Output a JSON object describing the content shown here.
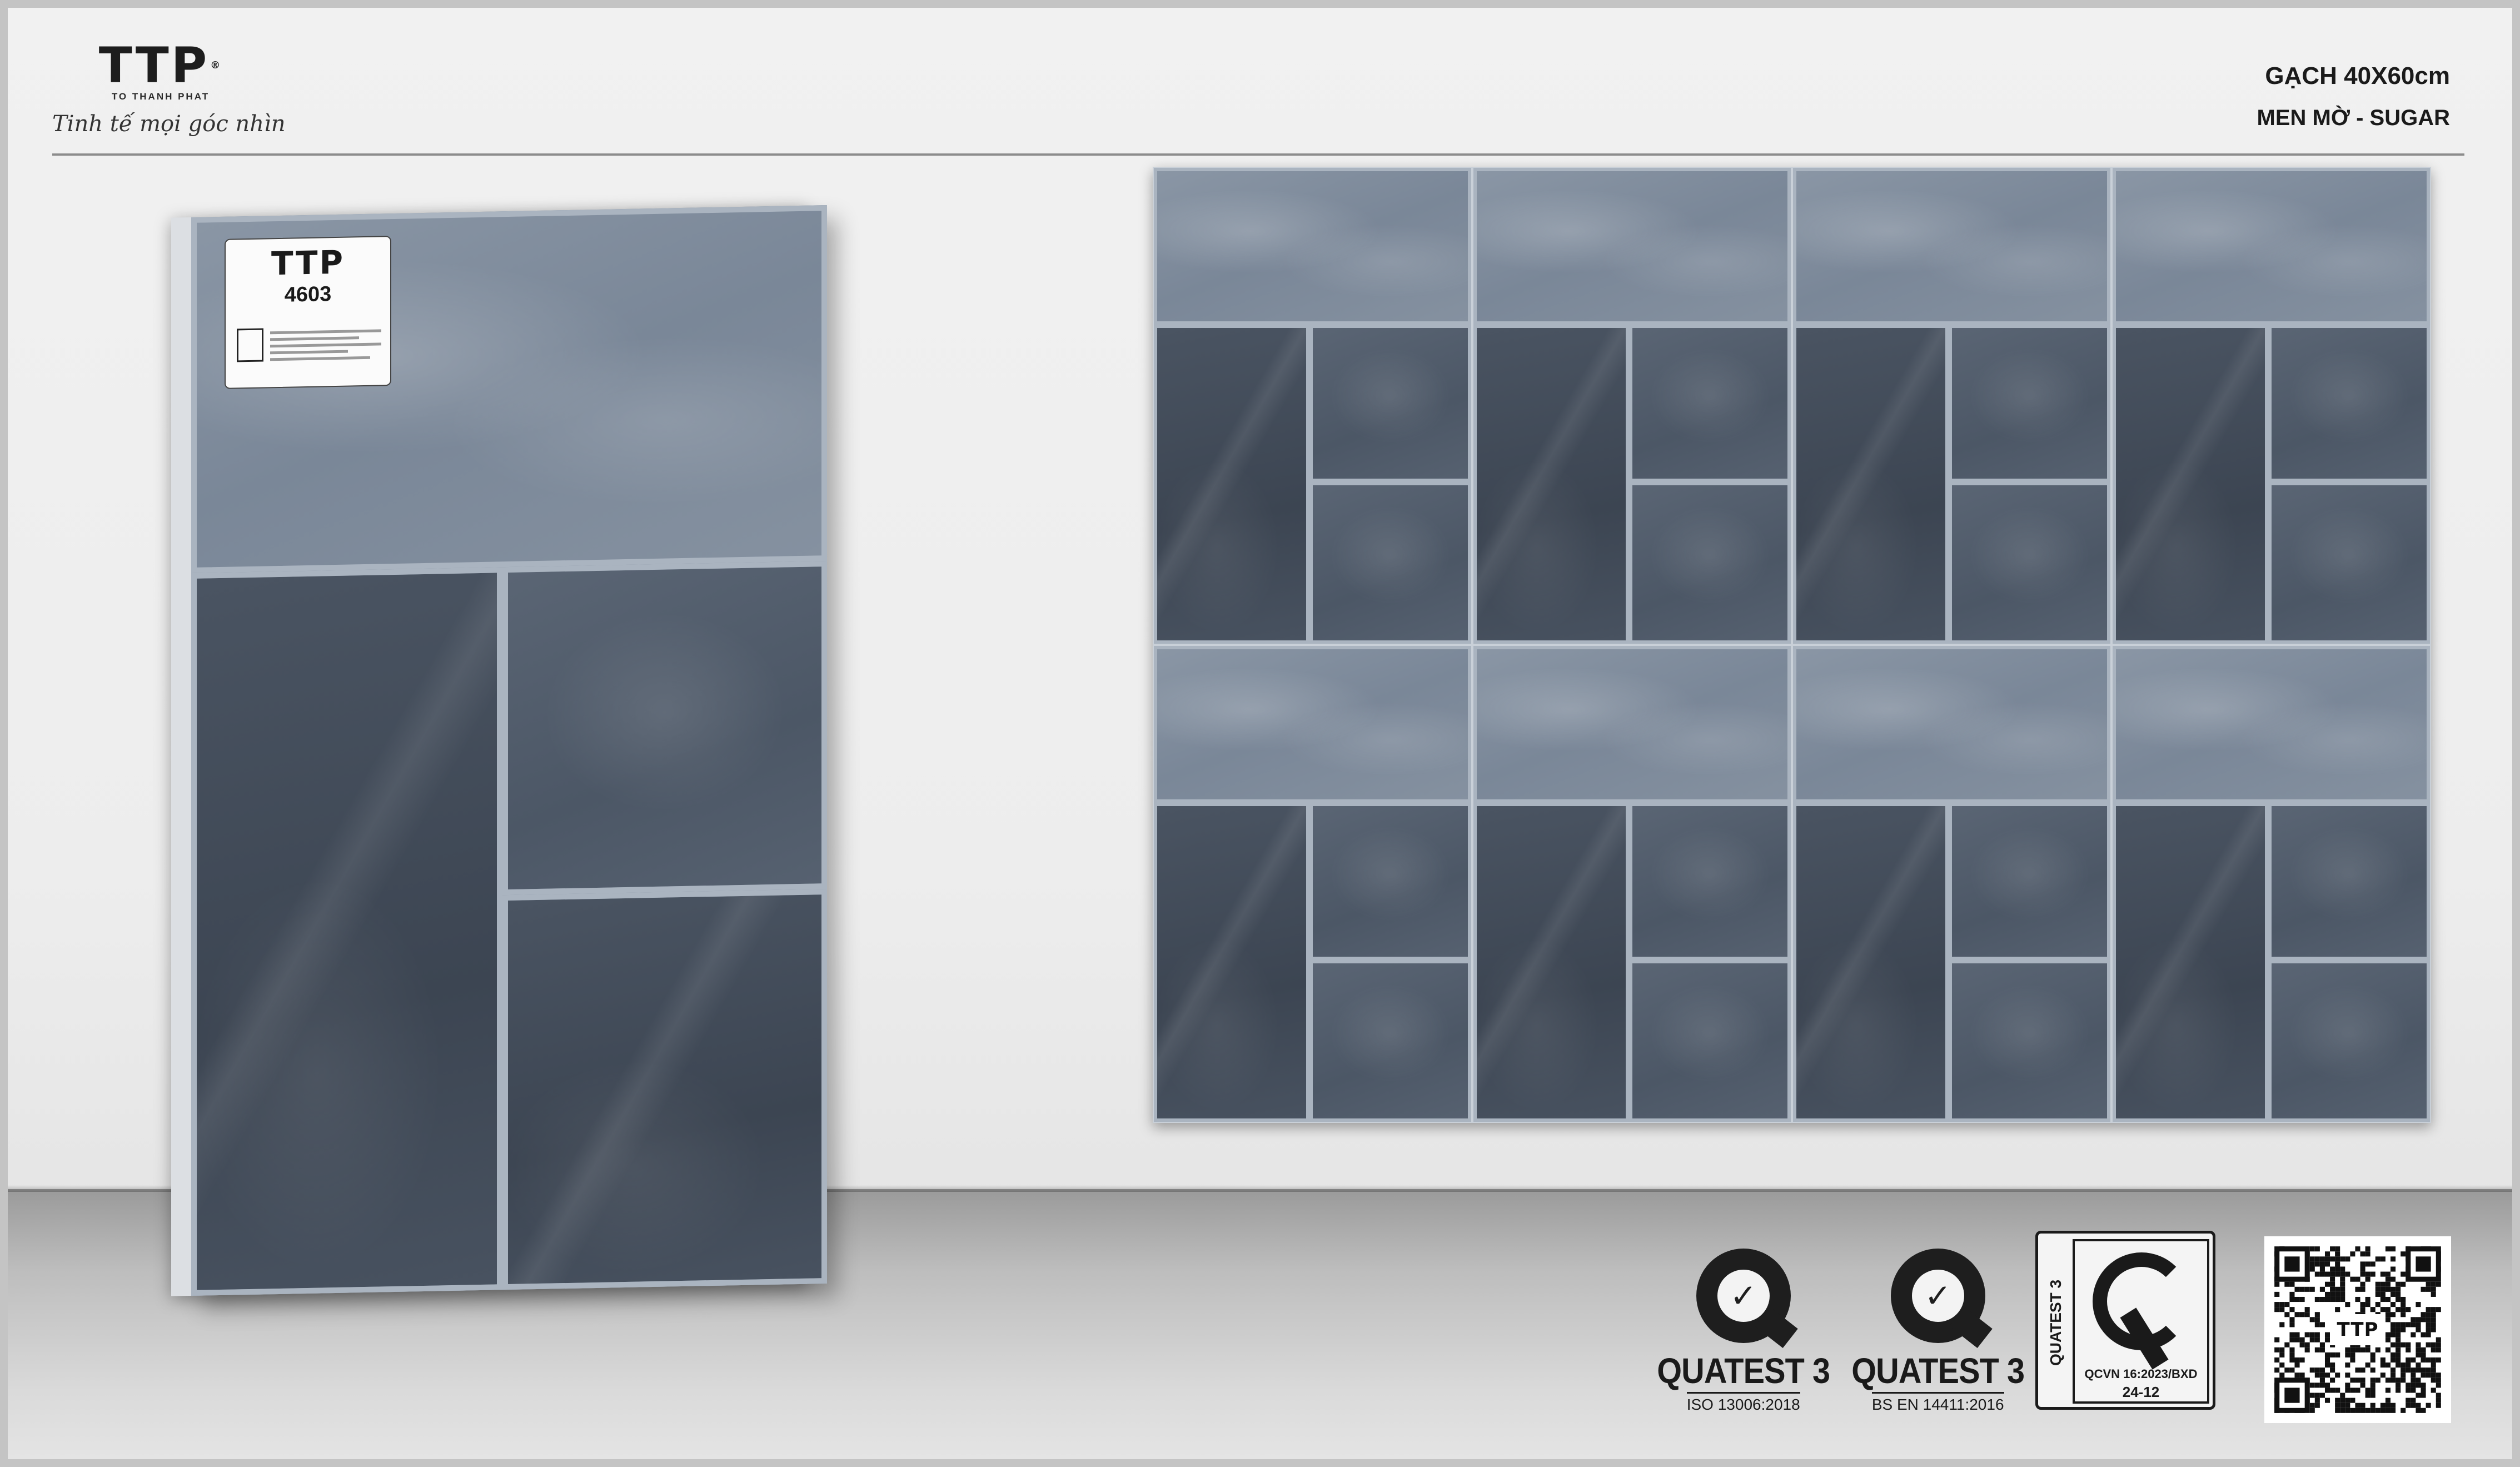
{
  "brand": {
    "logo_text": "TTP",
    "logo_sub": "TO THANH PHAT",
    "slogan": "Tinh tế mọi góc nhìn"
  },
  "product": {
    "title": "GẠCH 40X60cm",
    "finish": "MEN MỜ - SUGAR",
    "label_brand": "TTP",
    "code": "4603"
  },
  "certifications": [
    {
      "name": "QUATEST 3",
      "standard": "ISO 13006:2018"
    },
    {
      "name": "QUATEST 3",
      "standard": "BS EN 14411:2016"
    }
  ],
  "cr_mark": {
    "side_text": "QUATEST 3",
    "line1": "QCVN 16:2023/BXD",
    "line2": "24-12"
  },
  "qr": {
    "badge_text": "TTP"
  },
  "colors": {
    "background": "#eeeeee",
    "tile_light": "#7d8a9b",
    "tile_dark": "#434c59",
    "grout": "#aab4c0"
  }
}
